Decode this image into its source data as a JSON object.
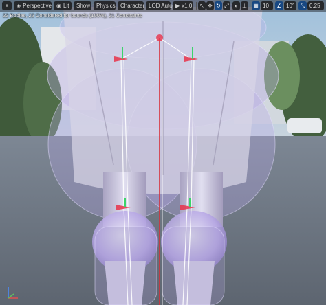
{
  "toolbar": {
    "menu_icon": "hamburger-icon",
    "perspective_label": "Perspective",
    "lit_label": "Lit",
    "show_label": "Show",
    "physics_label": "Physics",
    "character_label": "Character",
    "lod_label": "LOD Auto",
    "play_speed_label": "x1.0",
    "grid_snap_value": "10",
    "angle_snap_value": "10°",
    "scale_snap_value": "0.25",
    "icons": [
      "select-icon",
      "translate-icon",
      "rotate-icon",
      "scale-icon",
      "world-local-icon",
      "surface-snap-icon",
      "grid-snap-icon",
      "angle-snap-icon",
      "scale-snap-icon"
    ]
  },
  "stats": {
    "text": "22 Bodies, 22 Considered for bounds (100%), 21 Constraints"
  },
  "colors": {
    "toolbar_bg": "#222224",
    "toolbar_active": "#14467f",
    "physics_body": "#b7a7e6",
    "constraint_red": "#e8324a",
    "constraint_green": "#3cd46a",
    "spine_red": "#d8303a"
  }
}
